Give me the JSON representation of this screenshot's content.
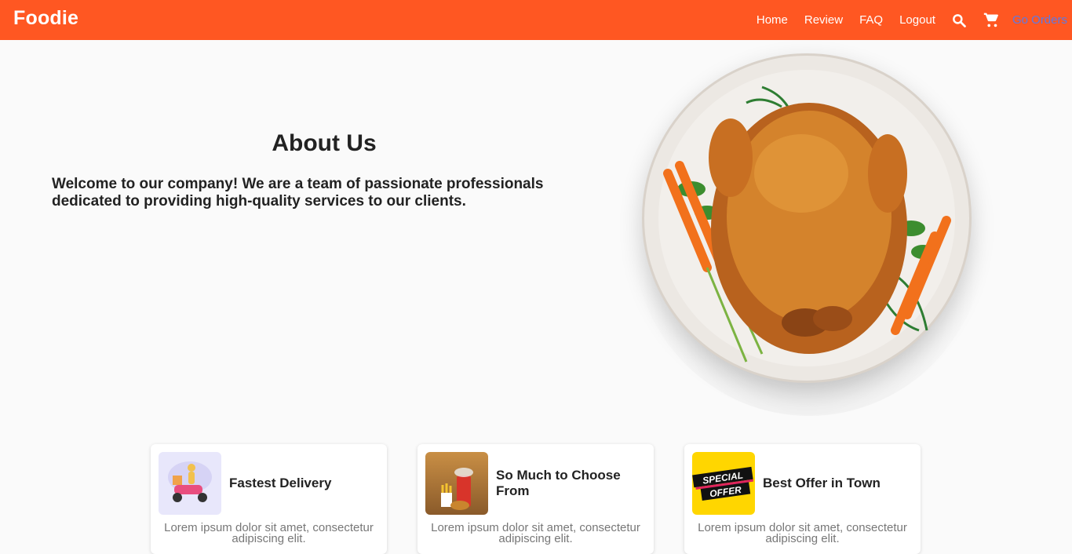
{
  "brand": "Foodie",
  "nav": {
    "home": "Home",
    "review": "Review",
    "faq": "FAQ",
    "logout": "Logout",
    "go_orders": "Go Orders"
  },
  "about": {
    "title": "About Us",
    "text": "Welcome to our company! We are a team of passionate professionals dedicated to providing high-quality services to our clients."
  },
  "features": [
    {
      "title": "Fastest Delivery",
      "body": "Lorem ipsum dolor sit amet, consectetur adipiscing elit."
    },
    {
      "title": "So Much to Choose From",
      "body": "Lorem ipsum dolor sit amet, consectetur adipiscing elit."
    },
    {
      "title": "Best Offer in Town",
      "body": "Lorem ipsum dolor sit amet, consectetur adipiscing elit."
    }
  ],
  "offer_badge": {
    "line1": "SPECIAL",
    "line2": "OFFER"
  },
  "colors": {
    "nav_bg": "#ff5722",
    "link_accent": "#5b79e6",
    "offer_yellow": "#ffd600"
  },
  "icons": [
    "search-icon",
    "cart-icon"
  ]
}
